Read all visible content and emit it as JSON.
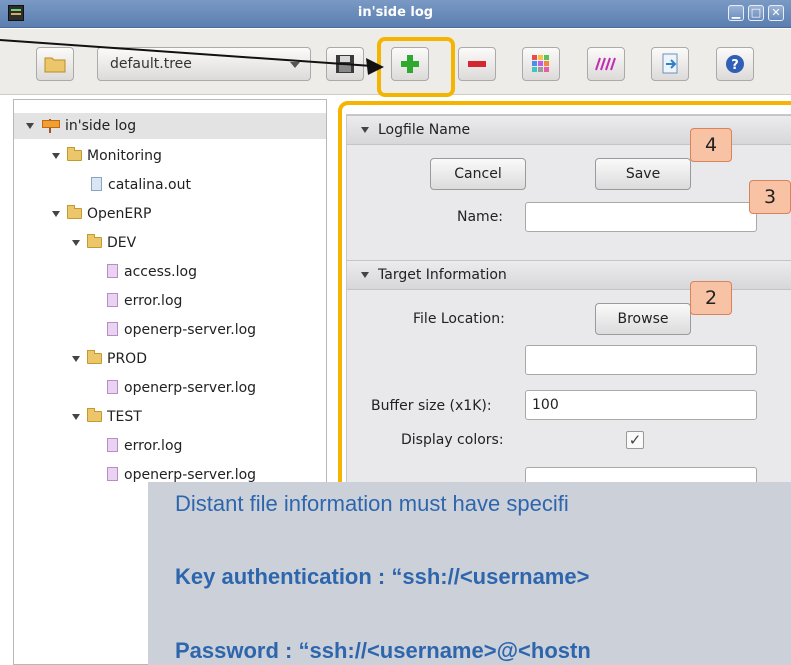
{
  "window": {
    "title": "in'side log"
  },
  "toolbar": {
    "tree_file": "default.tree",
    "buttons": [
      "open-folder",
      "save",
      "add",
      "remove",
      "colors",
      "pattern",
      "export",
      "help"
    ]
  },
  "tree": {
    "root": "in'side log",
    "items": [
      {
        "label": "Monitoring"
      },
      {
        "label": "catalina.out"
      },
      {
        "label": "OpenERP"
      },
      {
        "label": "DEV"
      },
      {
        "label": "access.log"
      },
      {
        "label": "error.log"
      },
      {
        "label": "openerp-server.log"
      },
      {
        "label": "PROD"
      },
      {
        "label": "openerp-server.log"
      },
      {
        "label": "TEST"
      },
      {
        "label": "error.log"
      },
      {
        "label": "openerp-server.log"
      }
    ]
  },
  "logfile_section": {
    "title": "Logfile Name",
    "cancel_label": "Cancel",
    "save_label": "Save",
    "name_label": "Name:",
    "name_value": ""
  },
  "target_section": {
    "title": "Target Information",
    "file_location_label": "File Location:",
    "browse_label": "Browse",
    "location_value": "",
    "buffer_label": "Buffer size (x1K):",
    "buffer_value": "100",
    "colors_label": "Display colors:",
    "colors_checked": "✓"
  },
  "badges": {
    "b2": "2",
    "b3": "3",
    "b4": "4"
  },
  "callout": {
    "line1": "Distant file information must have specifi",
    "line2": "Key authentication  : “ssh://<username>",
    "line3": "Password  : “ssh://<username>@<hostn"
  },
  "colors": {
    "highlight": "#f5b400",
    "callout_text": "#2e66ad",
    "badge": "#f7c3a4"
  }
}
